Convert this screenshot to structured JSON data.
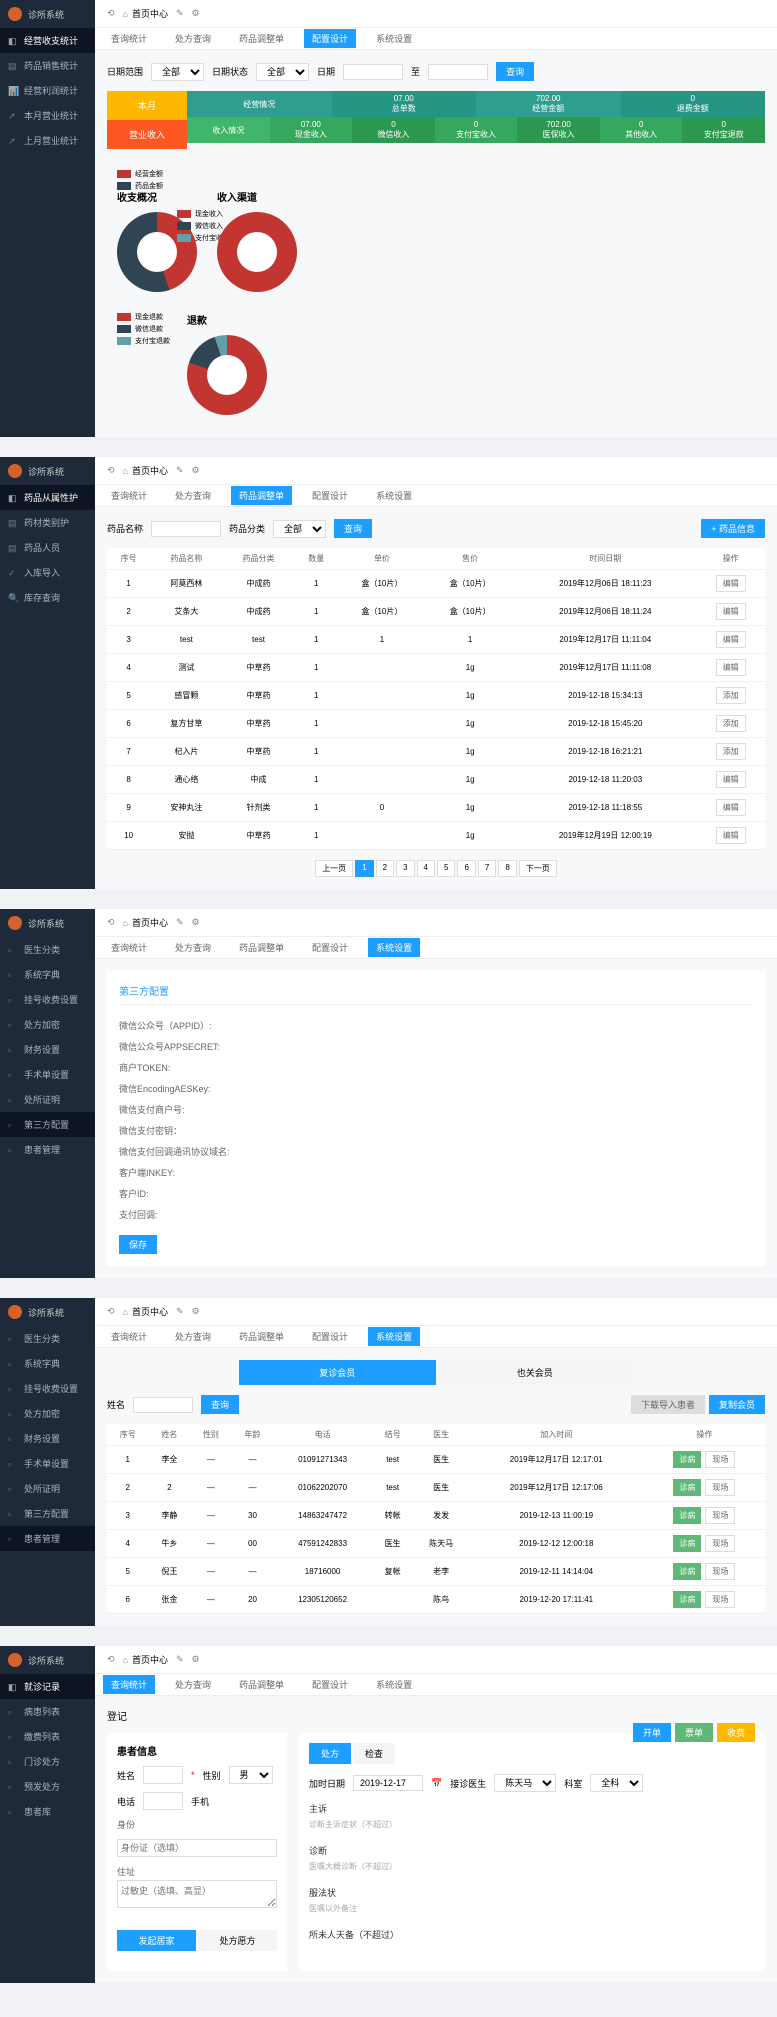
{
  "brand": "诊所系统",
  "topbar": {
    "home": "首页中心",
    "icons": [
      "⟲",
      "⌂",
      "✎",
      "⚙"
    ]
  },
  "tabs": [
    "查询统计",
    "处方查询",
    "药品调整单",
    "配置设计",
    "系统设置"
  ],
  "p1": {
    "sidemenu": {
      "title": "经营收支统计",
      "items": [
        "药品销售统计",
        "经营利润统计",
        "本月营业统计",
        "上月营业统计"
      ]
    },
    "filters": {
      "l1": "日期范围",
      "v1": "全部",
      "l2": "日期状态",
      "v2": "全部",
      "l3": "日期",
      "btn": "查询"
    },
    "stats": {
      "left": [
        "本月",
        "营业收入"
      ],
      "row1": {
        "label": "经营情况",
        "cells": [
          [
            "总单数",
            "07.00"
          ],
          [
            "经营金额",
            "702.00"
          ],
          [
            "退费金额",
            "0"
          ]
        ]
      },
      "row2": {
        "label": "收入情况",
        "cells": [
          [
            "现金收入",
            "07.00"
          ],
          [
            "微信收入",
            "0"
          ],
          [
            "支付宝收入",
            "0"
          ],
          [
            "医保收入",
            "702.00"
          ],
          [
            "其他收入",
            "0"
          ],
          [
            "支付宝退款",
            "0"
          ]
        ]
      }
    },
    "charts": {
      "c1": {
        "title": "收支概况",
        "legend": [
          [
            "#c23531",
            "经营金额"
          ],
          [
            "#2f4554",
            "药品金额"
          ]
        ]
      },
      "c2": {
        "title": "收入渠道",
        "legend": [
          [
            "#c23531",
            "现金收入"
          ],
          [
            "#2f4554",
            "微信收入"
          ],
          [
            "#61a0a8",
            "支付宝收入"
          ]
        ]
      },
      "c3": {
        "title": "退款",
        "legend": [
          [
            "#c23531",
            "现金退款"
          ],
          [
            "#2f4554",
            "微信退款"
          ],
          [
            "#61a0a8",
            "支付宝退款"
          ]
        ]
      }
    }
  },
  "p2": {
    "sidemenu": {
      "title": "药品从属性护",
      "items": [
        "药材类别护",
        "药品人员",
        "入库导入",
        "库存查询"
      ]
    },
    "filters": {
      "l1": "药品名称",
      "l2": "药品分类",
      "v2": "全部",
      "btn": "查询",
      "add": "+ 药品信息"
    },
    "thead": [
      "序号",
      "药品名称",
      "药品分类",
      "数量",
      "单价",
      "售价",
      "时间日期",
      "操作"
    ],
    "rows": [
      [
        "1",
        "阿莫西林",
        "中成药",
        "1",
        "盒（10片）",
        "盒（10片）",
        "2019年12月06日 18:11:23",
        "编辑"
      ],
      [
        "2",
        "艾条大",
        "中成药",
        "1",
        "盒（10片）",
        "盒（10片）",
        "2019年12月06日 18:11:24",
        "编辑"
      ],
      [
        "3",
        "test",
        "test",
        "1",
        "1",
        "1",
        "2019年12月17日 11:11:04",
        "编辑"
      ],
      [
        "4",
        "测试",
        "中草药",
        "1",
        "",
        "1g",
        "2019年12月17日 11:11:08",
        "编辑"
      ],
      [
        "5",
        "感冒颗",
        "中草药",
        "1",
        "",
        "1g",
        "2019-12-18 15:34:13",
        "添加"
      ],
      [
        "6",
        "复方甘草",
        "中草药",
        "1",
        "",
        "1g",
        "2019-12-18 15:45:20",
        "添加"
      ],
      [
        "7",
        "杞入片",
        "中草药",
        "1",
        "",
        "1g",
        "2019-12-18 16:21:21",
        "添加"
      ],
      [
        "8",
        "通心络",
        "中成",
        "1",
        "",
        "1g",
        "2019-12-18 11:20:03",
        "编辑"
      ],
      [
        "9",
        "安神丸注",
        "针剂类",
        "1",
        "0",
        "1g",
        "2019-12-18 11:18:55",
        "编辑"
      ],
      [
        "10",
        "安抛",
        "中草药",
        "1",
        "",
        "1g",
        "2019年12月19日 12:00:19",
        "编辑"
      ]
    ],
    "pages": [
      "上一页",
      "1",
      "2",
      "3",
      "4",
      "5",
      "6",
      "7",
      "8",
      "下一页"
    ]
  },
  "p3": {
    "sidemenu": {
      "title": "",
      "items": [
        "医生分类",
        "系统字典",
        "挂号收费设置",
        "处方加密",
        "财务设置",
        "手术单设置",
        "处所证明",
        "第三方配置",
        "患者管理"
      ]
    },
    "active": 7,
    "title": "第三方配置",
    "rows": [
      "微信公众号（APPID）:",
      "微信公众号APPSECRET:",
      "商户TOKEN:",
      "微信EncodingAESKey:",
      "微信支付商户号:",
      "微信支付密钥：",
      "微信支付回调通讯协议域名:",
      "客户端INKEY:",
      "客户ID:",
      "支付回调:"
    ],
    "btn": "保存"
  },
  "p4": {
    "sidemenu": {
      "items": [
        "医生分类",
        "系统字典",
        "挂号收费设置",
        "处方加密",
        "财务设置",
        "手术单设置",
        "处所证明",
        "第三方配置",
        "患者管理"
      ]
    },
    "pills": [
      "复诊会员",
      "也关会员"
    ],
    "filter": {
      "l": "姓名",
      "btn": "查询",
      "b1": "下载导入患者",
      "b2": "复制会员"
    },
    "thead": [
      "序号",
      "姓名",
      "性别",
      "年龄",
      "电话",
      "结号",
      "医生",
      "加入时间",
      "操作"
    ],
    "rows": [
      [
        "1",
        "李全",
        "—",
        "—",
        "01091271343",
        "test",
        "医生",
        "2019年12月17日 12:17:01",
        "诊病",
        "现场"
      ],
      [
        "2",
        "2",
        "—",
        "—",
        "01062202070",
        "test",
        "医生",
        "2019年12月17日 12:17:06",
        "诊病",
        "现场"
      ],
      [
        "3",
        "李静",
        "—",
        "30",
        "14863247472",
        "转帐",
        "发发",
        "2019-12-13 11:00:19",
        "诊病",
        "现场"
      ],
      [
        "4",
        "牛乡",
        "—",
        "00",
        "47591242833",
        "医生",
        "陈天马",
        "2019-12-12 12:00:18",
        "诊病",
        "现场"
      ],
      [
        "5",
        "倪王",
        "—",
        "—",
        "18716000",
        "复帐",
        "老李",
        "2019-12-11 14:14:04",
        "诊病",
        "现场"
      ],
      [
        "6",
        "张金",
        "—",
        "20",
        "12305120652",
        "",
        "陈鸟",
        "2019-12-20 17:11:41",
        "诊病",
        "现场"
      ]
    ]
  },
  "p5": {
    "sidemenu": {
      "title": "就诊记录",
      "items": [
        "病患列表",
        "缴费列表",
        "门诊处方",
        "预发处方",
        "患者库"
      ]
    },
    "title": "登记",
    "topbtns": [
      "开单",
      "票单",
      "收费"
    ],
    "left": {
      "section": "患者信息",
      "fields": {
        "name": "姓名",
        "sex": "性别",
        "sexv": "男",
        "tel": "电话",
        "mobile": "手机",
        "addr": "身份",
        "idcard": "身份证（选填）",
        "addr2": "住址",
        "diag": "过敏史（选填、高显）"
      },
      "tabs": [
        "发起居家",
        "处方愿方"
      ]
    },
    "right": {
      "tabs": [
        "处方",
        "检查"
      ],
      "fields": {
        "date": "加时日期",
        "datev": "2019-12-17",
        "doc": "接诊医生",
        "docv": "陈天马",
        "dept": "科室",
        "deptv": "全科"
      },
      "sections": [
        "主诉",
        "诊断主诉症状（不超过）",
        "诊断",
        "医嘱大概诊断（不超过）",
        "服法状",
        "医嘱以外备注",
        "所未人天备（不超过）"
      ]
    }
  }
}
